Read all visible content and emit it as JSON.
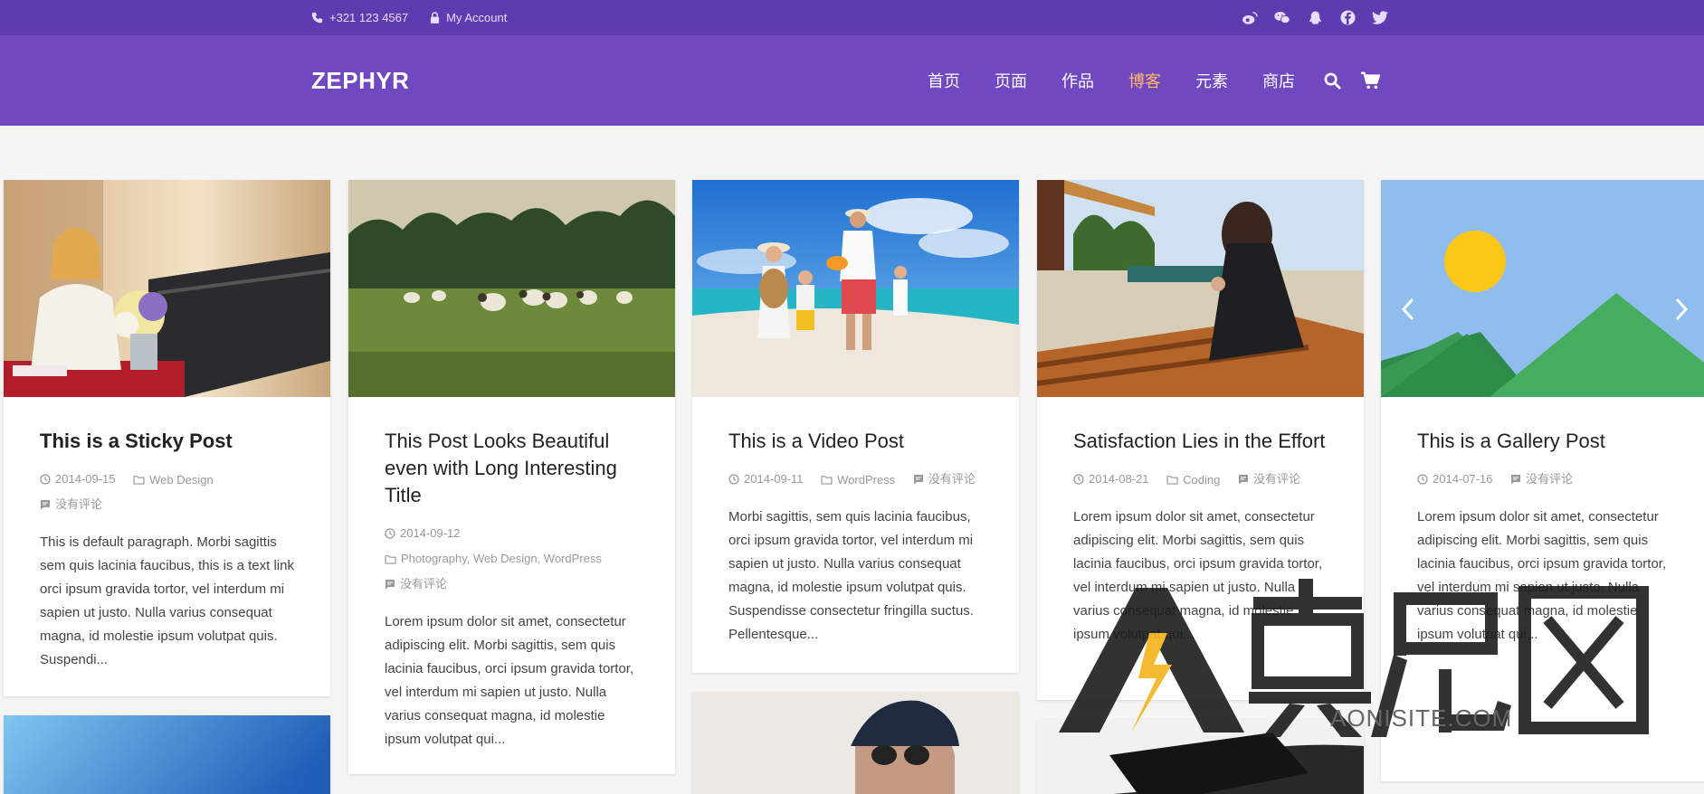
{
  "topbar": {
    "phone": "+321 123 4567",
    "account": "My Account",
    "social_icons": [
      "weibo-icon",
      "wechat-icon",
      "qq-icon",
      "facebook-icon",
      "twitter-icon"
    ]
  },
  "header": {
    "logo": "ZEPHYR",
    "nav": [
      {
        "label": "首页",
        "active": false
      },
      {
        "label": "页面",
        "active": false
      },
      {
        "label": "作品",
        "active": false
      },
      {
        "label": "博客",
        "active": true
      },
      {
        "label": "元素",
        "active": false
      },
      {
        "label": "商店",
        "active": false
      }
    ],
    "colors": {
      "topbar": "#5e3cb0",
      "header": "#7048bf",
      "active_nav": "#ffb766"
    }
  },
  "posts": [
    {
      "title": "This is a Sticky Post",
      "date": "2014-09-15",
      "categories": "Web Design",
      "comments": "没有评论",
      "excerpt": "This is default paragraph. Morbi sagittis sem quis lacinia faucibus, this is a text link orci ipsum gravida tortor, vel interdum mi sapien ut justo. Nulla varius consequat magna, id molestie ipsum volutpat quis. Suspendi..."
    },
    {
      "title": "This Post Looks Beautiful even with Long Interesting Title",
      "date": "2014-09-12",
      "categories": "Photography, Web Design, WordPress",
      "comments": "没有评论",
      "excerpt": "Lorem ipsum dolor sit amet, consectetur adipiscing elit. Morbi sagittis, sem quis lacinia faucibus, orci ipsum gravida tortor, vel interdum mi sapien ut justo. Nulla varius consequat magna, id molestie ipsum volutpat qui..."
    },
    {
      "title": "This is a Video Post",
      "date": "2014-09-11",
      "categories": "WordPress",
      "comments": "没有评论",
      "excerpt": "Morbi sagittis, sem quis lacinia faucibus, orci ipsum gravida tortor, vel interdum mi sapien ut justo. Nulla varius consequat magna, id molestie ipsum volutpat quis. Suspendisse consectetur fringilla suctus. Pellentesque..."
    },
    {
      "title": "Satisfaction Lies in the Effort",
      "date": "2014-08-21",
      "categories": "Coding",
      "comments": "没有评论",
      "excerpt": "Lorem ipsum dolor sit amet, consectetur adipiscing elit. Morbi sagittis, sem quis lacinia faucibus, orci ipsum gravida tortor, vel interdum mi sapien ut justo. Nulla varius consequat magna, id molestie ipsum volutpat qui..."
    },
    {
      "title": "This is a Gallery Post",
      "date": "2014-07-16",
      "comments": "没有评论",
      "excerpt": "Lorem ipsum dolor sit amet, consectetur adipiscing elit. Morbi sagittis, sem quis lacinia faucibus, orci ipsum gravida tortor, vel interdum mi sapien ut justo. Nulla varius consequat magna, id molestie ipsum volutpat qui..."
    }
  ],
  "watermark": {
    "text": "AONISITE.COM"
  }
}
